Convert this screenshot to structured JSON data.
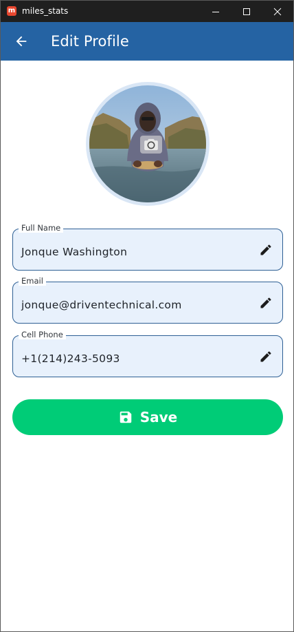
{
  "window": {
    "app_icon_letter": "m",
    "title": "miles_stats"
  },
  "appbar": {
    "title": "Edit Profile"
  },
  "profile": {
    "fields": [
      {
        "label": "Full Name",
        "value": "Jonque Washington"
      },
      {
        "label": "Email",
        "value": "jonque@driventechnical.com"
      },
      {
        "label": "Cell Phone",
        "value": "+1(214)243-5093"
      }
    ],
    "save_label": "Save"
  },
  "colors": {
    "appbar": "#2563a3",
    "save": "#00cc77",
    "field_fill": "#e8f1fc",
    "field_border": "#2d5f94"
  },
  "icons": {
    "back": "arrow-left-icon",
    "camera": "camera-icon",
    "edit": "pencil-icon",
    "save": "floppy-disk-icon"
  }
}
